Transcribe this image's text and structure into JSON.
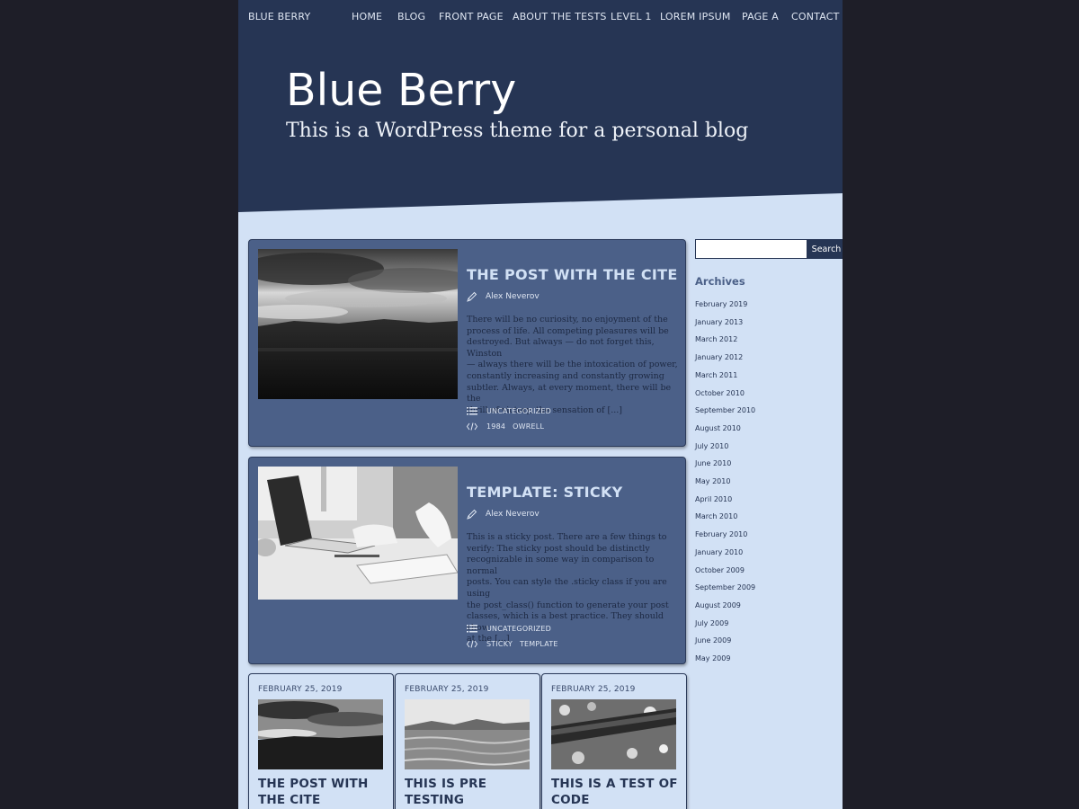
{
  "nav": {
    "brand": "BLUE BERRY",
    "items": [
      "HOME",
      "BLOG",
      "FRONT PAGE",
      "ABOUT THE TESTS",
      "LEVEL 1",
      "LOREM IPSUM",
      "PAGE A",
      "CONTACT"
    ]
  },
  "site": {
    "title": "Blue Berry",
    "description": "This is a WordPress theme for a personal blog"
  },
  "posts": [
    {
      "title": "THE POST WITH THE CITE",
      "author": "Alex Neverov",
      "excerpt_lines": [
        "There will be no curiosity, no enjoyment of the",
        "process of life. All competing pleasures will be",
        "destroyed. But always — do not forget this, Winston",
        "— always there will be the intoxication of power,",
        "constantly increasing and constantly growing",
        "subtler. Always, at every moment, there will be the",
        "thrill of victory, the sensation of [...]"
      ],
      "category": "UNCATEGORIZED",
      "tags": [
        "1984",
        "OWRELL"
      ]
    },
    {
      "title": "TEMPLATE: STICKY",
      "author": "Alex Neverov",
      "excerpt_lines": [
        "This is a sticky post. There are a few things to",
        "verify: The sticky post should be distinctly",
        "recognizable in some way in comparison to normal",
        "posts. You can style the .sticky class if you are using",
        "the post_class() function to generate your post",
        "classes, which is a best practice. They should show",
        "at the [...]"
      ],
      "category": "UNCATEGORIZED",
      "tags": [
        "STICKY",
        "TEMPLATE"
      ]
    }
  ],
  "small_posts": [
    {
      "date": "FEBRUARY 25, 2019",
      "title": "THE POST WITH THE CITE"
    },
    {
      "date": "FEBRUARY 25, 2019",
      "title": "THIS IS PRE TESTING"
    },
    {
      "date": "FEBRUARY 25, 2019",
      "title": "THIS IS A TEST OF CODE"
    }
  ],
  "sidebar": {
    "search_button": "Search",
    "search_value": "",
    "archives_title": "Archives",
    "archives": [
      "February 2019",
      "January 2013",
      "March 2012",
      "January 2012",
      "March 2011",
      "October 2010",
      "September 2010",
      "August 2010",
      "July 2010",
      "June 2010",
      "May 2010",
      "April 2010",
      "March 2010",
      "February 2010",
      "January 2010",
      "October 2009",
      "September 2009",
      "August 2009",
      "July 2009",
      "June 2009",
      "May 2009"
    ]
  }
}
